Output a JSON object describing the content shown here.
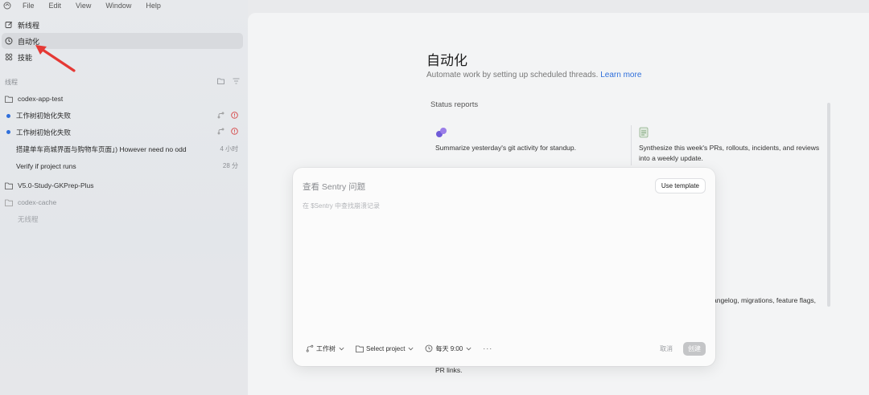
{
  "menubar": {
    "app_icon": "codex-logo-icon",
    "items": [
      "File",
      "Edit",
      "View",
      "Window",
      "Help"
    ]
  },
  "nav": {
    "items": [
      {
        "label": "新线程",
        "icon": "edit-icon"
      },
      {
        "label": "自动化",
        "icon": "clock-icon",
        "active": true
      },
      {
        "label": "技能",
        "icon": "grid-icon"
      }
    ]
  },
  "threads_section": {
    "title": "线程",
    "projects": [
      {
        "name": "codex-app-test",
        "threads": [
          {
            "title": "工作树初始化失败",
            "unread": true,
            "error": true
          },
          {
            "title": "工作树初始化失败",
            "unread": true,
            "error": true
          },
          {
            "title": "搭建单车商城界面与购物车页面」) However need no odd",
            "time": "4 小时"
          },
          {
            "title": "Verify if project runs",
            "time": "28 分"
          }
        ]
      },
      {
        "name": "V5.0-Study-GKPrep-Plus",
        "threads": []
      },
      {
        "name": "codex-cache",
        "dim": true,
        "empty_label": "无线程"
      }
    ]
  },
  "main": {
    "title": "自动化",
    "subtitle": "Automate work by setting up scheduled threads.",
    "learn_more": "Learn more",
    "section_title": "Status reports",
    "cards": [
      {
        "text": "Summarize yesterday's git activity for standup.",
        "icon": "sparkle-icon"
      },
      {
        "text_line1": "Synthesize this week's PRs, rollouts, incidents, and reviews",
        "text_line2": "into a weekly update.",
        "icon": "document-icon"
      }
    ],
    "partial_text_1": "angelog, migrations, feature flags,",
    "partial_text_2": "PR links."
  },
  "modal": {
    "title": "查看 Sentry 问题",
    "description": "在 $Sentry 中查找崩溃记录",
    "use_template": "Use template",
    "footer": {
      "worktree": "工作树",
      "project": "Select project",
      "schedule": "每天 9:00",
      "more": "···",
      "cancel": "取消",
      "create": "创建"
    }
  },
  "colors": {
    "accent": "#2f6fdb",
    "error": "#d64545",
    "sidebar_bg": "#e5e7ea",
    "main_bg": "#f3f4f5",
    "modal_bg": "#fbfbfb"
  }
}
